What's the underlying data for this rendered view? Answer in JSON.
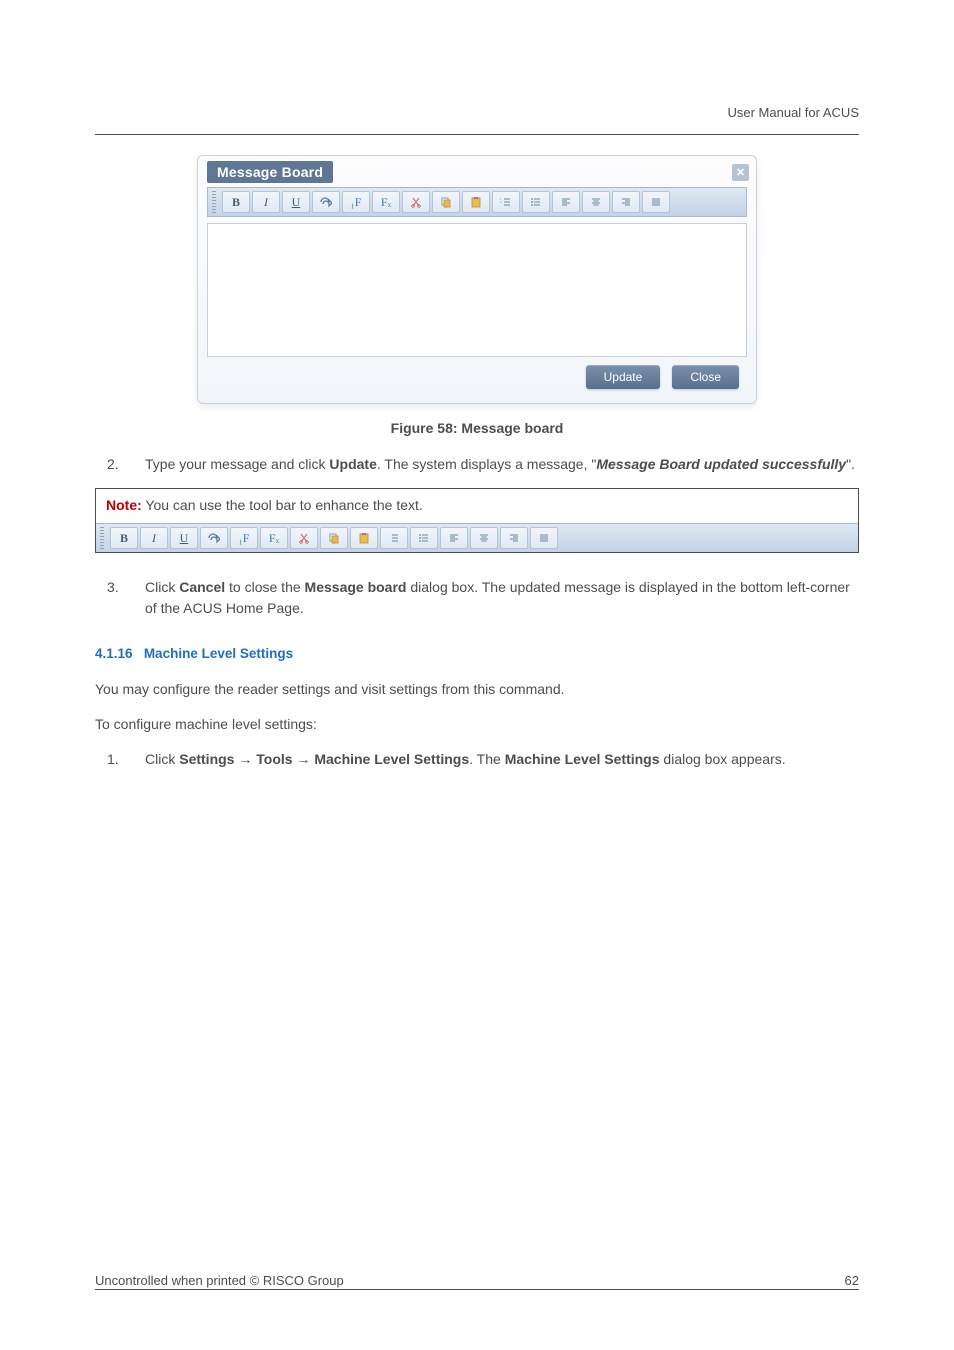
{
  "header": {
    "right": "User Manual for ACUS"
  },
  "dialog": {
    "title": "Message Board",
    "close_glyph": "✕",
    "actions": {
      "update": "Update",
      "close": "Close"
    }
  },
  "toolbar": {
    "bold": "B",
    "italic": "I",
    "underline": "U",
    "font_increase": "F",
    "font_decrease": "Fₓ"
  },
  "figure_caption": "Figure 58: Message board",
  "step2": {
    "num": "2.",
    "pre": "Type your message and click ",
    "bold1": "Update",
    "mid": ". The system displays a message, \"",
    "emph": "Message Board updated successfully",
    "post": "\"."
  },
  "note": {
    "label": "Note:",
    "text": " You can use the tool bar to enhance the text."
  },
  "step3": {
    "num": "3.",
    "pre": "Click ",
    "bold1": "Cancel",
    "mid1": " to close the ",
    "bold2": "Message board",
    "post": " dialog box. The updated message is displayed in the bottom left-corner of the ACUS Home Page."
  },
  "section": {
    "num": "4.1.16",
    "title": "Machine Level Settings"
  },
  "para1": "You may configure the reader settings and visit settings from this command.",
  "para2": "To configure machine level settings:",
  "step_mls": {
    "num": "1.",
    "pre": "Click ",
    "b1": "Settings",
    "arrow": " → ",
    "b2": "Tools",
    "b3": "Machine Level Settings",
    "mid": ". The ",
    "b4": "Machine Level Settings",
    "post": " dialog box appears."
  },
  "footer": {
    "left": "Uncontrolled when printed © RISCO Group",
    "right": "62"
  }
}
